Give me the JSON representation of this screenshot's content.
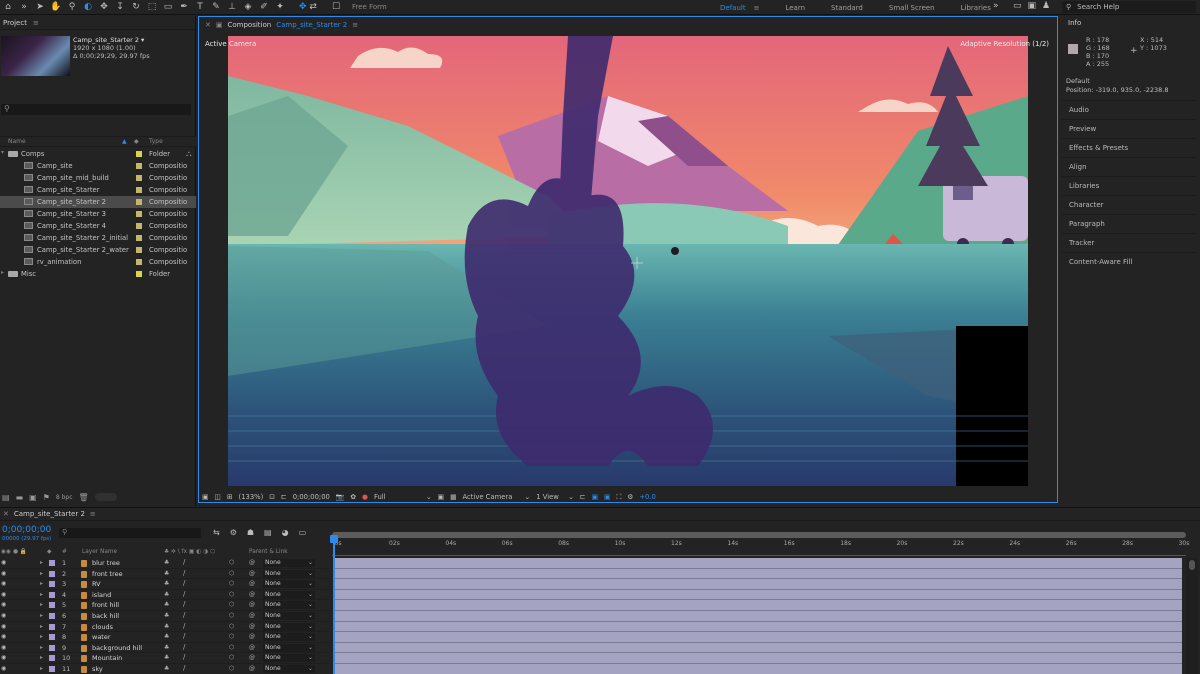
{
  "toolbar": {
    "tools": [
      "home-icon",
      "select-icon",
      "hand-icon",
      "zoom-icon",
      "camera-orbit-icon",
      "move-icon",
      "dolly-icon",
      "rotate-icon",
      "behind-icon",
      "rectangle-icon",
      "pen-icon",
      "type-icon",
      "brush-icon",
      "clone-icon",
      "eraser-icon",
      "roto-icon",
      "pin-icon"
    ],
    "freeform": "Free Form",
    "workspaces": [
      "Default",
      "Learn",
      "Standard",
      "Small Screen",
      "Libraries"
    ],
    "search_placeholder": "Search Help"
  },
  "project": {
    "tab": "Project",
    "comp_name": "Camp_site_Starter 2 ▾",
    "comp_size": "1920 x 1080 (1.00)",
    "comp_duration": "Δ 0;00;29;29, 29.97 fps",
    "search_placeholder": "⚲",
    "col_name": "Name",
    "col_type": "Type",
    "items": [
      {
        "name": "Comps",
        "type": "Folder",
        "kind": "folder",
        "indent": 0,
        "label_color": "#d9d24a",
        "selected": false
      },
      {
        "name": "Camp_site",
        "type": "Compositio",
        "kind": "comp",
        "indent": 1,
        "label_color": "#c4b66a",
        "selected": false
      },
      {
        "name": "Camp_site_mid_build",
        "type": "Compositio",
        "kind": "comp",
        "indent": 1,
        "label_color": "#c4b66a",
        "selected": false
      },
      {
        "name": "Camp_site_Starter",
        "type": "Compositio",
        "kind": "comp",
        "indent": 1,
        "label_color": "#c4b66a",
        "selected": false
      },
      {
        "name": "Camp_site_Starter 2",
        "type": "Compositio",
        "kind": "comp",
        "indent": 1,
        "label_color": "#c4b66a",
        "selected": true
      },
      {
        "name": "Camp_site_Starter 3",
        "type": "Compositio",
        "kind": "comp",
        "indent": 1,
        "label_color": "#c4b66a",
        "selected": false
      },
      {
        "name": "Camp_site_Starter 4",
        "type": "Compositio",
        "kind": "comp",
        "indent": 1,
        "label_color": "#c4b66a",
        "selected": false
      },
      {
        "name": "Camp_site_Starter 2_initial",
        "type": "Compositio",
        "kind": "comp",
        "indent": 1,
        "label_color": "#c4b66a",
        "selected": false
      },
      {
        "name": "Camp_site_Starter 2_water",
        "type": "Compositio",
        "kind": "comp",
        "indent": 1,
        "label_color": "#c4b66a",
        "selected": false
      },
      {
        "name": "rv_animation",
        "type": "Compositio",
        "kind": "comp",
        "indent": 1,
        "label_color": "#c4b66a",
        "selected": false
      },
      {
        "name": "Misc",
        "type": "Folder",
        "kind": "folder",
        "indent": 0,
        "label_color": "#d9d24a",
        "selected": false
      }
    ],
    "bpc": "8 bpc"
  },
  "composition": {
    "tab_prefix": "Composition",
    "tab_name": "Camp_site_Starter 2",
    "active_camera": "Active Camera",
    "adaptive": "Adaptive Resolution (1/2)",
    "zoom": "(133%)",
    "timecode": "0;00;00;00",
    "resolution": "Full",
    "view": "Active Camera",
    "views": "1 View",
    "exposure": "+0.0"
  },
  "info": {
    "tab": "Info",
    "r": "R :  178",
    "g": "G :  168",
    "b": "B :  170",
    "a": "A :  255",
    "x": "X :  514",
    "y": "Y :  1073",
    "def": "Default",
    "position": "Position: -319.0, 935.0, -2238.8",
    "swatch_color": "#b2a8aa",
    "panels": [
      "Audio",
      "Preview",
      "Effects & Presets",
      "Align",
      "Libraries",
      "Character",
      "Paragraph",
      "Tracker",
      "Content-Aware Fill"
    ]
  },
  "timeline": {
    "tab": "Camp_site_Starter 2",
    "timecode": "0;00;00;00",
    "fps": "00000 (29.97 fps)",
    "search_placeholder": "⚲",
    "col_layer_name": "Layer Name",
    "col_parent": "Parent & Link",
    "col_hash": "#",
    "ruler": [
      "0s",
      "02s",
      "04s",
      "06s",
      "08s",
      "10s",
      "12s",
      "14s",
      "16s",
      "18s",
      "20s",
      "22s",
      "24s",
      "26s",
      "28s",
      "30s"
    ],
    "layers": [
      {
        "num": "1",
        "name": "blur tree",
        "parent": "None"
      },
      {
        "num": "2",
        "name": "front tree",
        "parent": "None"
      },
      {
        "num": "3",
        "name": "RV",
        "parent": "None"
      },
      {
        "num": "4",
        "name": "island",
        "parent": "None"
      },
      {
        "num": "5",
        "name": "front hill",
        "parent": "None"
      },
      {
        "num": "6",
        "name": "back hill",
        "parent": "None"
      },
      {
        "num": "7",
        "name": "clouds",
        "parent": "None"
      },
      {
        "num": "8",
        "name": "water",
        "parent": "None"
      },
      {
        "num": "9",
        "name": "background hill",
        "parent": "None"
      },
      {
        "num": "10",
        "name": "Mountain",
        "parent": "None"
      },
      {
        "num": "11",
        "name": "sky",
        "parent": "None"
      }
    ]
  },
  "colors": {
    "accent": "#2d8ceb",
    "layer_label": "#a79ad0",
    "layer_bar": "#a4a4c2"
  }
}
